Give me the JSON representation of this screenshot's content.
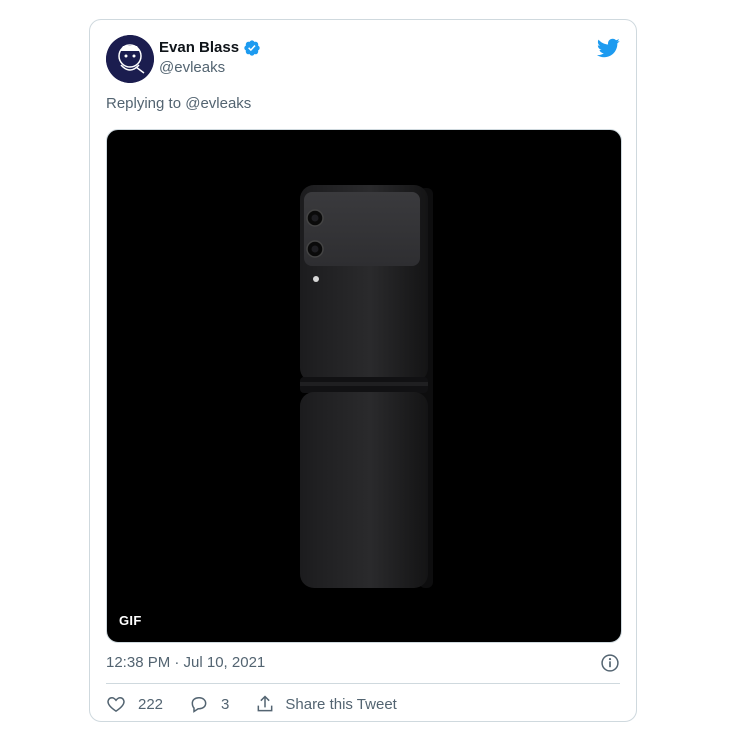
{
  "tweet": {
    "author_name": "Evan Blass",
    "author_handle": "@evleaks",
    "reply_prefix": "Replying to",
    "reply_handle": "@evleaks",
    "media_badge": "GIF",
    "timestamp": "12:38 PM · Jul 10, 2021",
    "likes": "222",
    "replies": "3",
    "share_label": "Share this Tweet"
  },
  "icons": {
    "brand": "twitter-bird-icon",
    "verified": "verified-badge-icon",
    "info": "info-icon",
    "like": "heart-icon",
    "reply": "reply-bubble-icon",
    "share": "share-icon"
  },
  "colors": {
    "brand": "#1d9bf0",
    "text_primary": "#0f1419",
    "text_secondary": "#536471",
    "border": "#cfd9de",
    "media_bg": "#000000"
  }
}
